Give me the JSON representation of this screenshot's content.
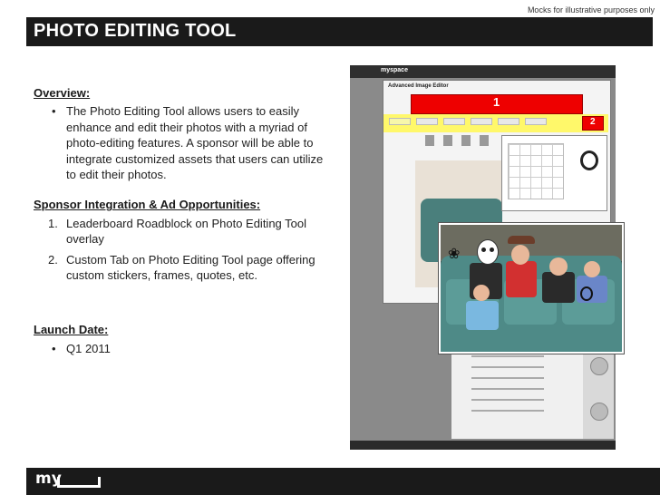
{
  "mock_note": "Mocks for illustrative purposes only",
  "title": "PHOTO EDITING TOOL",
  "overview": {
    "heading": "Overview:",
    "bullets": [
      "The Photo Editing Tool allows users to easily enhance and edit their photos with a myriad of photo-editing features.  A sponsor will be able to integrate customized assets that users can utilize to edit their photos."
    ]
  },
  "sponsor": {
    "heading": "Sponsor Integration & Ad Opportunities:",
    "items": [
      {
        "num": "1.",
        "text": "Leaderboard Roadblock on Photo Editing Tool overlay"
      },
      {
        "num": "2.",
        "text": "Custom Tab on Photo Editing Tool page offering custom stickers, frames, quotes, etc."
      }
    ]
  },
  "launch": {
    "heading": "Launch Date:",
    "bullets": [
      "Q1 2011"
    ]
  },
  "screenshot": {
    "logo": "myspace",
    "dialog_title": "Advanced Image Editor",
    "label_1": "1",
    "label_2": "2"
  },
  "footer": {
    "brand": "my"
  },
  "colors": {
    "title_bar": "#1a1a1a",
    "callout": "#ee0000",
    "highlight": "#fff86a"
  }
}
